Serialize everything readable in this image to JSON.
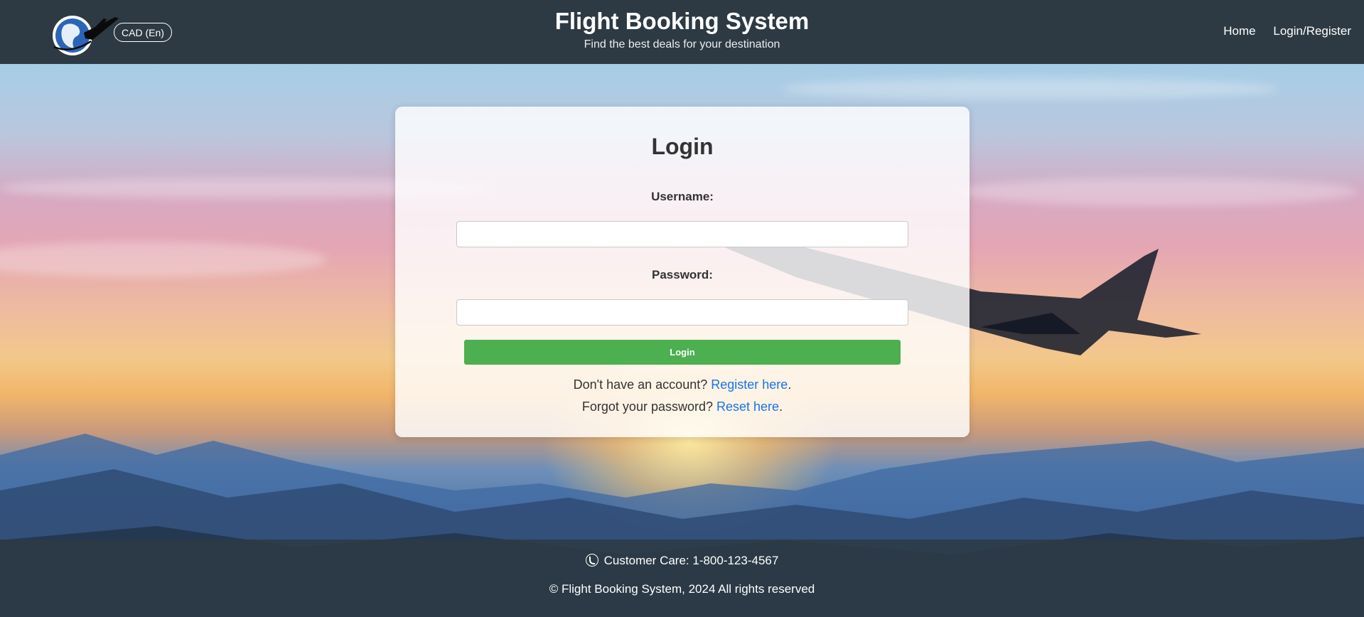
{
  "header": {
    "currency_button": "CAD (En)",
    "title": "Flight Booking System",
    "subtitle": "Find the best deals for your destination",
    "nav": [
      {
        "label": "Home"
      },
      {
        "label": "Login/Register"
      }
    ],
    "logo_icon": "globe-plane-icon"
  },
  "login": {
    "heading": "Login",
    "username_label": "Username:",
    "username_value": "",
    "password_label": "Password:",
    "password_value": "",
    "submit_label": "Login",
    "register_prompt": "Don't have an account?",
    "register_link": "Register here",
    "register_suffix": ".",
    "reset_prompt": "Forgot your password?",
    "reset_link": "Reset here",
    "reset_suffix": "."
  },
  "footer": {
    "customer_care": "Customer Care: 1-800-123-4567",
    "copyright": "© Flight Booking System, 2024 All rights reserved",
    "phone_icon": "phone-icon"
  },
  "colors": {
    "header_bg": "#2d3a43",
    "button_green": "#4caf50",
    "link_blue": "#1a73e8"
  }
}
